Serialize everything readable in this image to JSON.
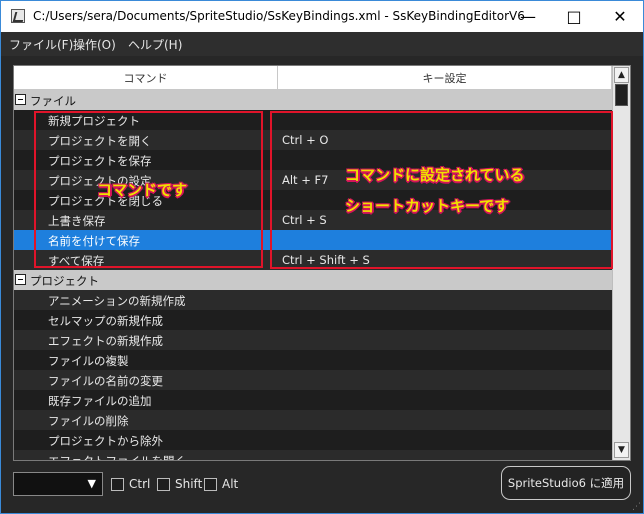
{
  "window": {
    "title": "C:/Users/sera/Documents/SpriteStudio/SsKeyBindings.xml - SsKeyBindingEditorV6",
    "app_icon": "app-icon",
    "controls": [
      "minimize-icon",
      "maximize-icon",
      "close-icon"
    ]
  },
  "menubar": {
    "items": [
      "ファイル(F)",
      "操作(O)",
      "ヘルプ(H)"
    ]
  },
  "table": {
    "columns": [
      "コマンド",
      "キー設定"
    ],
    "rows": [
      {
        "type": "group",
        "label": "ファイル"
      },
      {
        "type": "item",
        "command": "新規プロジェクト",
        "key": ""
      },
      {
        "type": "item",
        "command": "プロジェクトを開く",
        "key": "Ctrl + O"
      },
      {
        "type": "item",
        "command": "プロジェクトを保存",
        "key": ""
      },
      {
        "type": "item",
        "command": "プロジェクトの設定",
        "key": "Alt + F7"
      },
      {
        "type": "item",
        "command": "プロジェクトを閉じる",
        "key": ""
      },
      {
        "type": "item",
        "command": "上書き保存",
        "key": "Ctrl + S"
      },
      {
        "type": "item",
        "command": "名前を付けて保存",
        "key": "",
        "selected": true
      },
      {
        "type": "item",
        "command": "すべて保存",
        "key": "Ctrl + Shift + S"
      },
      {
        "type": "group",
        "label": "プロジェクト"
      },
      {
        "type": "item",
        "command": "アニメーションの新規作成",
        "key": ""
      },
      {
        "type": "item",
        "command": "セルマップの新規作成",
        "key": ""
      },
      {
        "type": "item",
        "command": "エフェクトの新規作成",
        "key": ""
      },
      {
        "type": "item",
        "command": "ファイルの複製",
        "key": ""
      },
      {
        "type": "item",
        "command": "ファイルの名前の変更",
        "key": ""
      },
      {
        "type": "item",
        "command": "既存ファイルの追加",
        "key": ""
      },
      {
        "type": "item",
        "command": "ファイルの削除",
        "key": ""
      },
      {
        "type": "item",
        "command": "プロジェクトから除外",
        "key": ""
      },
      {
        "type": "item",
        "command": "エフェクトファイルを開く",
        "key": ""
      }
    ]
  },
  "annotations": {
    "left_label": "コマンドです",
    "right_line1": "コマンドに設定されている",
    "right_line2": "ショートカットキーです",
    "color": "#e0142a"
  },
  "bottom": {
    "modifiers": [
      "Ctrl",
      "Shift",
      "Alt"
    ],
    "apply_button": "SpriteStudio6 に適用"
  }
}
